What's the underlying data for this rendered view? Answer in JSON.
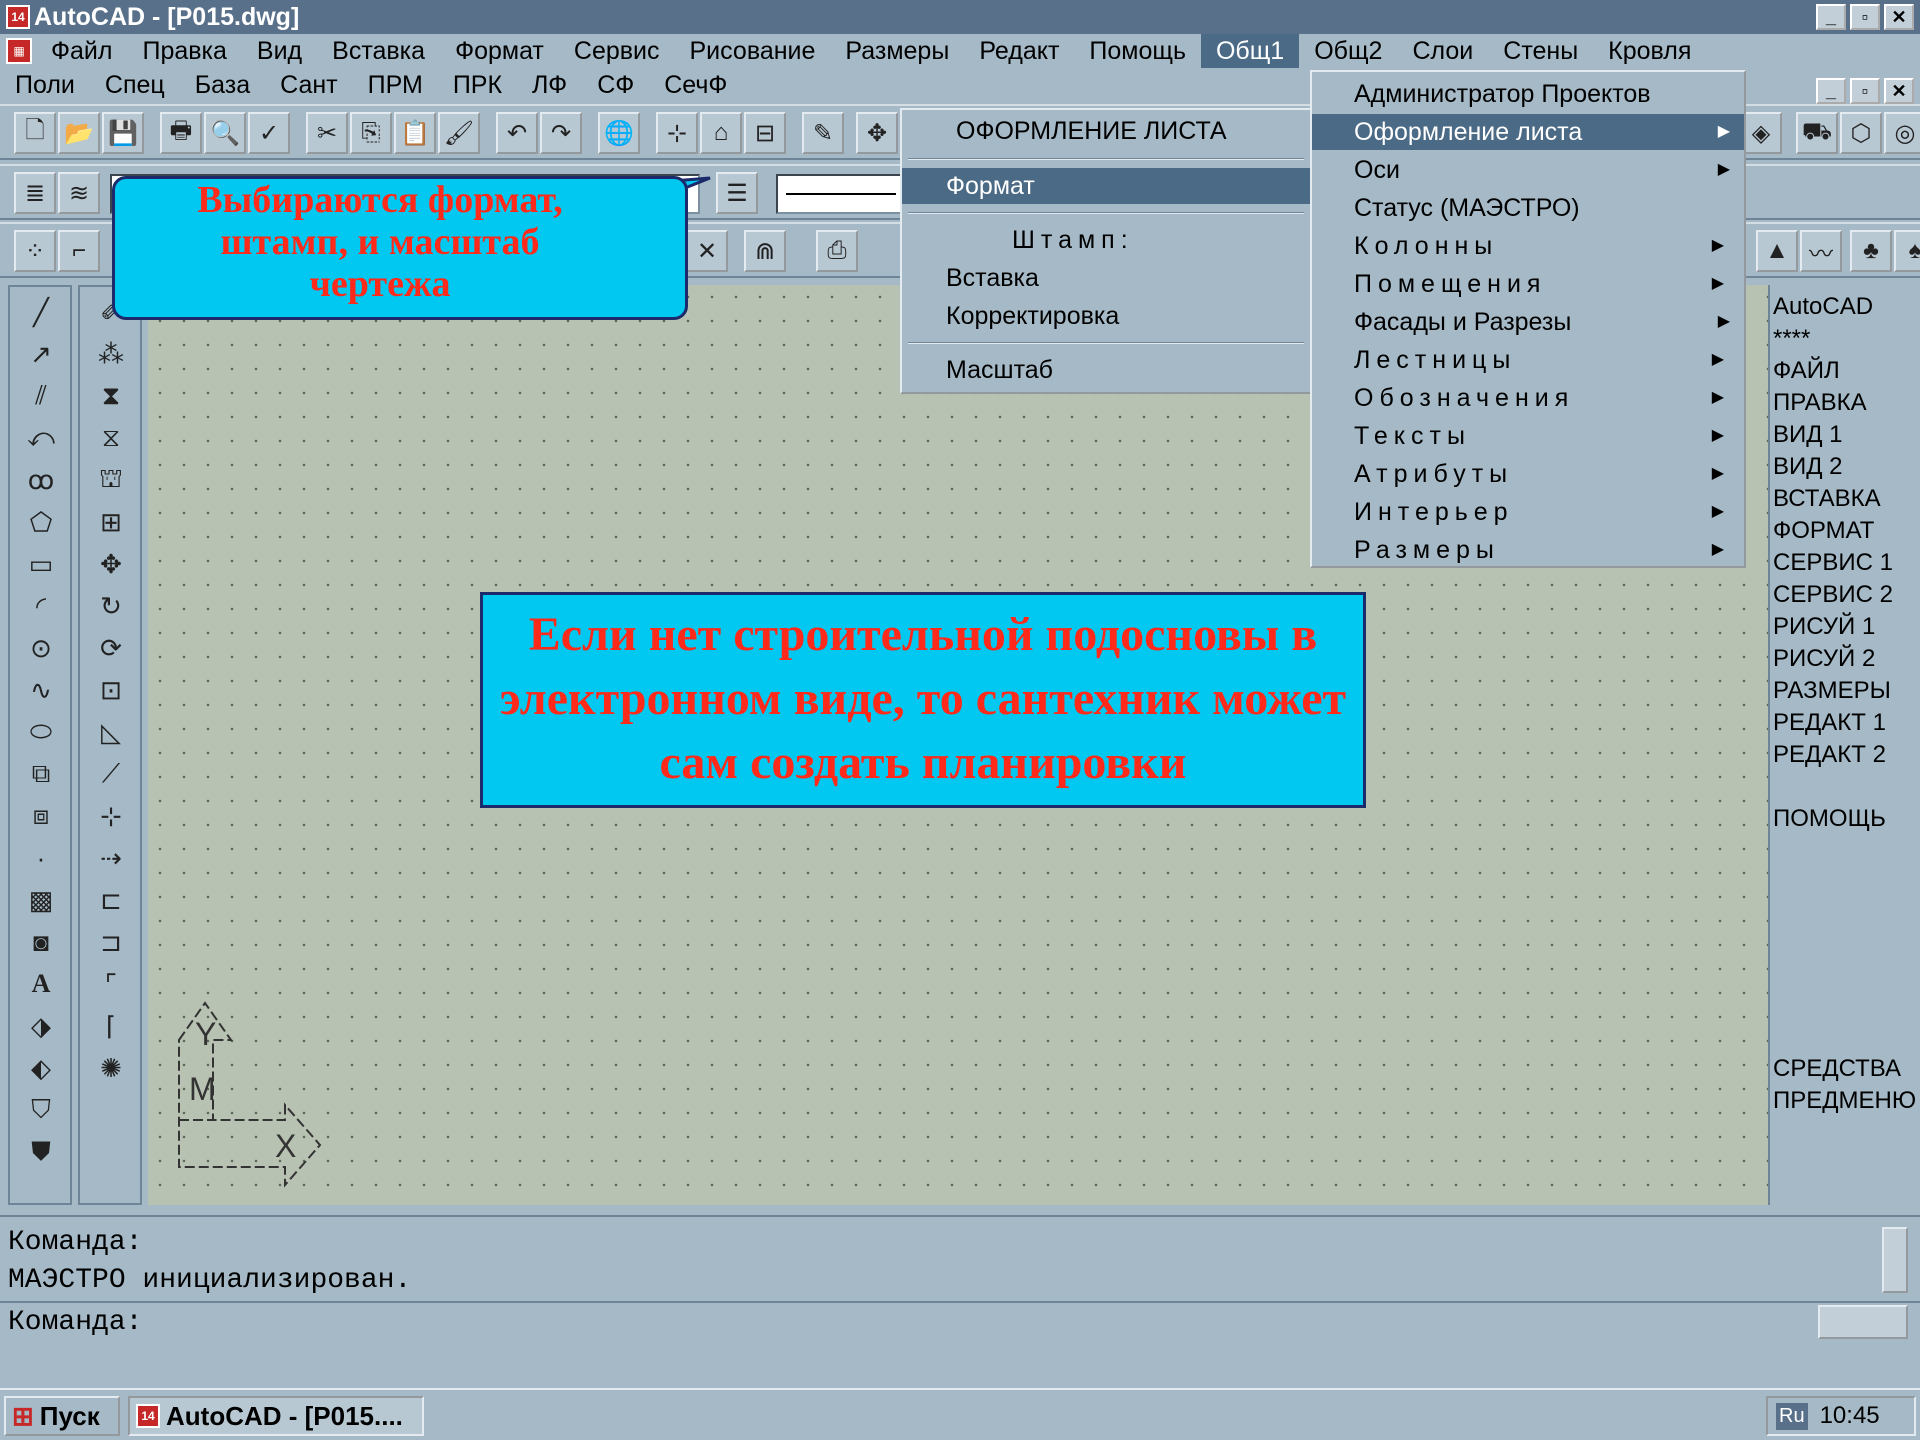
{
  "window": {
    "title": "AutoCAD - [P015.dwg]",
    "min": "_",
    "max": "▫",
    "close": "✕"
  },
  "menubar1": [
    "Файл",
    "Правка",
    "Вид",
    "Вставка",
    "Формат",
    "Сервис",
    "Рисование",
    "Размеры",
    "Редакт",
    "Помощь",
    "Общ1",
    "Общ2",
    "Слои",
    "Стены",
    "Кровля"
  ],
  "menubar2": [
    "Поли",
    "Спец",
    "База",
    "Сант",
    "ПРМ",
    "ПРК",
    "ЛФ",
    "СФ",
    "СечФ"
  ],
  "main_menu": {
    "items": [
      "Администратор Проектов",
      "Оформление листа",
      "Оси",
      "Статус (МАЭСТРО)",
      "Колонны",
      "Помещения",
      "Фасады и Разрезы",
      "Лестницы",
      "Обозначения",
      "Тексты",
      "Атрибуты",
      "Интерьер",
      "Размеры"
    ]
  },
  "submenu": {
    "header": "ОФОРМЛЕНИЕ ЛИСТА",
    "format": "Формат",
    "stamp_label": "Штамп:",
    "insert": "Вставка",
    "correct": "Корректировка",
    "scale": "Масштаб"
  },
  "side_menu": [
    "AutoCAD",
    "****",
    "ФАЙЛ",
    "ПРАВКА",
    "ВИД 1",
    "ВИД 2",
    "ВСТАВКА",
    "ФОРМАТ",
    "СЕРВИС 1",
    "СЕРВИС 2",
    "РИСУЙ 1",
    "РИСУЙ 2",
    "РАЗМЕРЫ",
    "РЕДАКТ 1",
    "РЕДАКТ 2",
    "",
    "ПОМОЩЬ"
  ],
  "side_menu_bottom": [
    "СРЕДСТВА",
    "ПРЕДМЕНЮ"
  ],
  "callouts": {
    "small": "Выбираются формат, штамп, и масштаб чертежа",
    "big": "Если нет строительной подосновы в электронном виде, то сантехник может сам создать планировки"
  },
  "ucs": {
    "y": "Y",
    "m": "M",
    "x": "X"
  },
  "command": {
    "line1": "Команда:",
    "line2": "МАЭСТРО инициализирован.",
    "prompt": "Команда:"
  },
  "taskbar": {
    "start": "Пуск",
    "task": "AutoCAD - [P015....",
    "lang": "Ru",
    "time": "10:45"
  }
}
